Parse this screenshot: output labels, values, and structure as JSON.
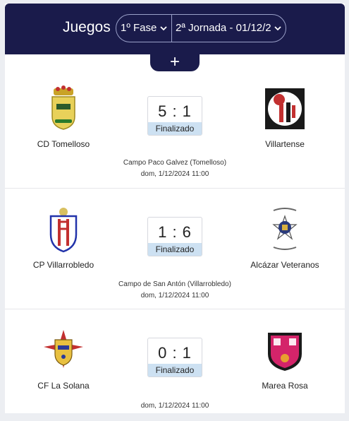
{
  "header": {
    "title": "Juegos",
    "phase": "1º Fase",
    "round": "2ª Jornada - 01/12/2",
    "add_label": "+"
  },
  "matches": [
    {
      "home": {
        "name": "CD Tomelloso",
        "logo_icon": "tomelloso-crest-icon"
      },
      "away": {
        "name": "Villartense",
        "logo_icon": "villartense-crest-icon"
      },
      "score": "5 : 1",
      "status": "Finalizado",
      "venue": "Campo Paco Galvez (Tomelloso)",
      "datetime": "dom, 1/12/2024 11:00"
    },
    {
      "home": {
        "name": "CP Villarrobledo",
        "logo_icon": "villarrobledo-crest-icon"
      },
      "away": {
        "name": "Alcázar Veteranos",
        "logo_icon": "alcazar-crest-icon"
      },
      "score": "1 : 6",
      "status": "Finalizado",
      "venue": "Campo de San Antón (Villarrobledo)",
      "datetime": "dom, 1/12/2024 11:00"
    },
    {
      "home": {
        "name": "CF La Solana",
        "logo_icon": "la-solana-crest-icon"
      },
      "away": {
        "name": "Marea Rosa",
        "logo_icon": "marea-rosa-crest-icon"
      },
      "score": "0 : 1",
      "status": "Finalizado",
      "venue": "",
      "datetime": "dom, 1/12/2024 11:00"
    }
  ],
  "colors": {
    "header_bg": "#1a1b4b",
    "status_bg": "#cde1f2",
    "separator": "#e6e6ea"
  }
}
